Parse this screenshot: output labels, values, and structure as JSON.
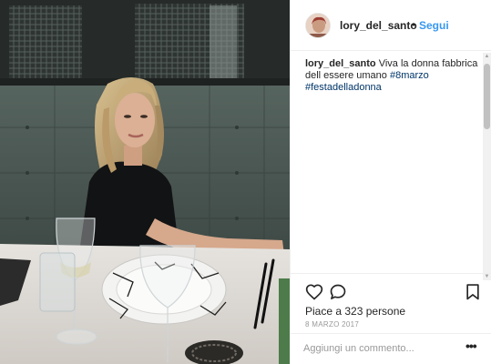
{
  "post": {
    "photo_icon": "photo-of-woman-seated-at-restaurant-table",
    "header": {
      "username": "lory_del_santo",
      "separator": "•",
      "follow_label": "Segui"
    },
    "caption": {
      "username": "lory_del_santo",
      "text": " Viva la donna fabbrica dell essere umano ",
      "hashtags": [
        "#8marzo",
        "#festadelladonna"
      ]
    },
    "actions": {
      "like_icon": "heart-icon",
      "comment_icon": "comment-bubble-icon",
      "save_icon": "bookmark-icon"
    },
    "likes_text": "Piace a 323 persone",
    "date_text": "8 MARZO 2017",
    "comment": {
      "placeholder": "Aggiungi un commento...",
      "more_label": "•••"
    }
  },
  "colors": {
    "link_blue": "#3897f0",
    "hashtag_blue": "#003569",
    "text_dark": "#262626",
    "text_muted": "#999999"
  }
}
